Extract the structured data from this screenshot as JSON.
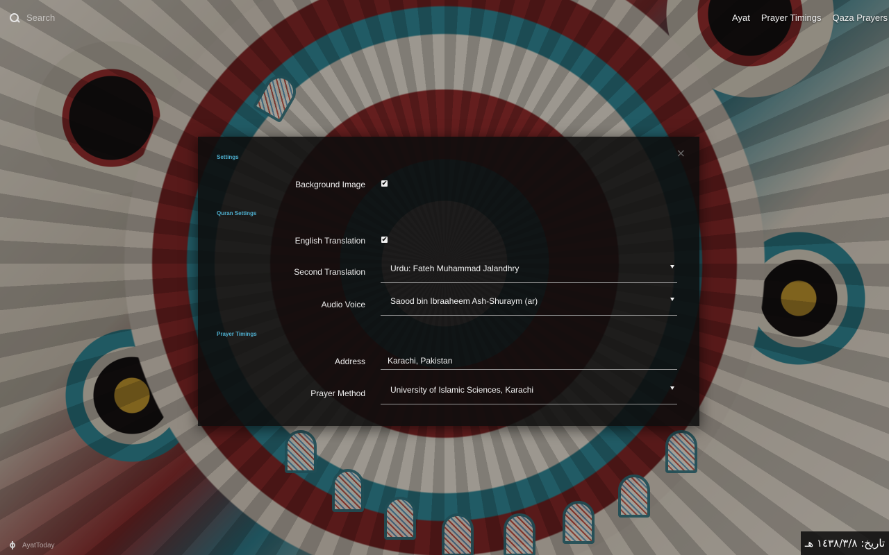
{
  "topbar": {
    "search_placeholder": "Search",
    "nav": [
      "Ayat",
      "Prayer Timings",
      "Qaza Prayers"
    ]
  },
  "settings": {
    "close_label": "×",
    "sections": {
      "general": "Settings",
      "quran": "Quran Settings",
      "prayer": "Prayer Timings"
    },
    "background_image": {
      "label": "Background Image",
      "checked": true,
      "mark": "✔"
    },
    "english_translation": {
      "label": "English Translation",
      "checked": true,
      "mark": "✔"
    },
    "second_translation": {
      "label": "Second Translation",
      "value": "Urdu: Fateh Muhammad Jalandhry"
    },
    "audio_voice": {
      "label": "Audio Voice",
      "value": "Saood bin Ibraaheem Ash-Shuraym (ar)"
    },
    "address": {
      "label": "Address",
      "value": "Karachi, Pakistan"
    },
    "prayer_method": {
      "label": "Prayer Method",
      "value": "University of Islamic Sciences, Karachi"
    }
  },
  "footer": {
    "settings_label": "AyatToday",
    "hijri_date": "تاریخ: ١٤٣٨/٣/٨ هـ"
  },
  "colors": {
    "section_title": "#4fb0d0",
    "modal_bg": "#0c0c0c"
  }
}
